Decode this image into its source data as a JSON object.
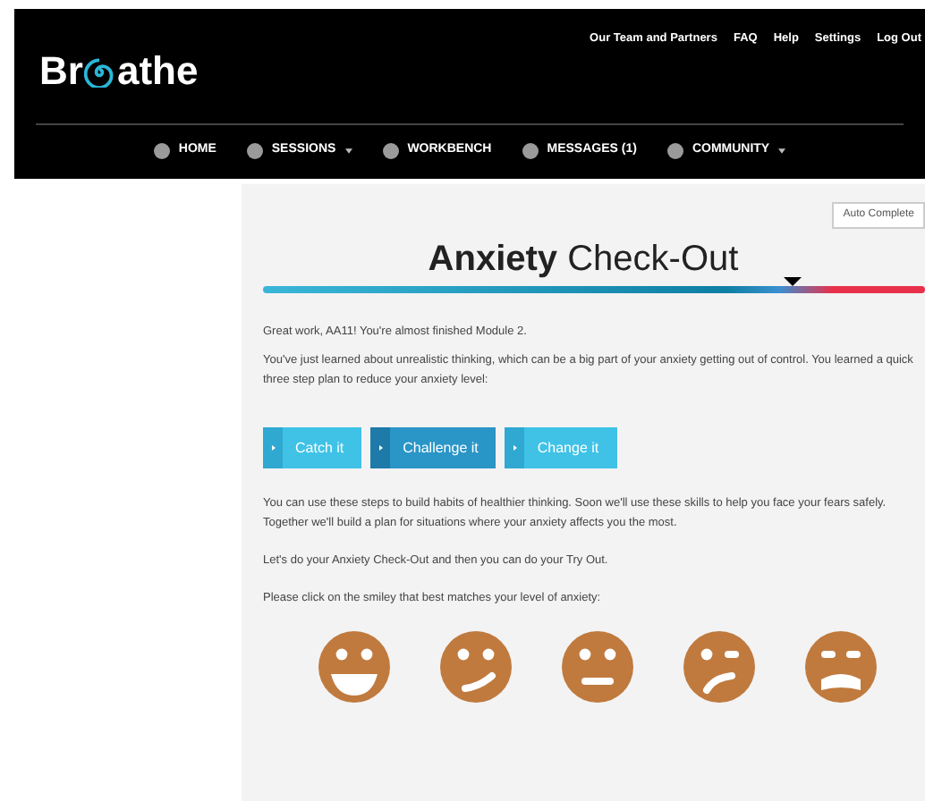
{
  "header": {
    "logo": {
      "before": "Br",
      "after": "athe"
    },
    "top_links": [
      "Our Team and Partners",
      "FAQ",
      "Help",
      "Settings",
      "Log Out"
    ],
    "nav": [
      {
        "label": "HOME",
        "dropdown": false
      },
      {
        "label": "SESSIONS",
        "dropdown": true
      },
      {
        "label": "WORKBENCH",
        "dropdown": false
      },
      {
        "label": "MESSAGES (1)",
        "dropdown": false
      },
      {
        "label": "COMMUNITY",
        "dropdown": true
      }
    ]
  },
  "auto_complete": "Auto Complete",
  "title": {
    "bold": "Anxiety",
    "rest": "Check-Out"
  },
  "progress": {
    "level": 0.8
  },
  "paragraphs": [
    "Great work, AA11! You're almost finished Module 2.",
    "You've just learned about unrealistic thinking, which can be a big part of your anxiety getting out of control. You learned a quick three step plan to reduce your anxiety level:"
  ],
  "steps": [
    {
      "label": "Catch it",
      "selected": false
    },
    {
      "label": "Challenge it",
      "selected": true
    },
    {
      "label": "Change it",
      "selected": false
    }
  ],
  "paragraphs_after": [
    "You can use these steps to build habits of healthier thinking. Soon we'll use these skills to help you face your fears safely. Together we'll build a plan for situations where your anxiety affects you the most.",
    "Let's do your Anxiety Check-Out and then you can do your Try Out.",
    "Please click on the smiley that best matches your level of anxiety:"
  ],
  "smileys": [
    {
      "kind": "grin"
    },
    {
      "kind": "smirk"
    },
    {
      "kind": "flat"
    },
    {
      "kind": "worried"
    },
    {
      "kind": "distressed"
    }
  ]
}
